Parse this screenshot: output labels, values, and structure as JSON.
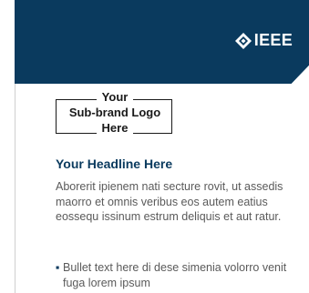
{
  "header": {
    "brand_name": "IEEE",
    "icon": "ieee-diamond-icon",
    "band_color": "#0a3a5e"
  },
  "subbrand": {
    "line1": "Your",
    "line2": "Sub-brand Logo",
    "line3": "Here"
  },
  "content": {
    "headline": "Your Headline Here",
    "headline_color": "#0a3a5e",
    "body": "Aborerit ipienem nati secture rovit, ut assedis maorro et omnis veribus eos autem eatius eossequ issinum estrum deliquis et aut ratur.",
    "bullets": [
      {
        "marker": "▪",
        "text": "Bullet text here di dese simenia volorro venit fuga lorem ipsum"
      }
    ]
  }
}
